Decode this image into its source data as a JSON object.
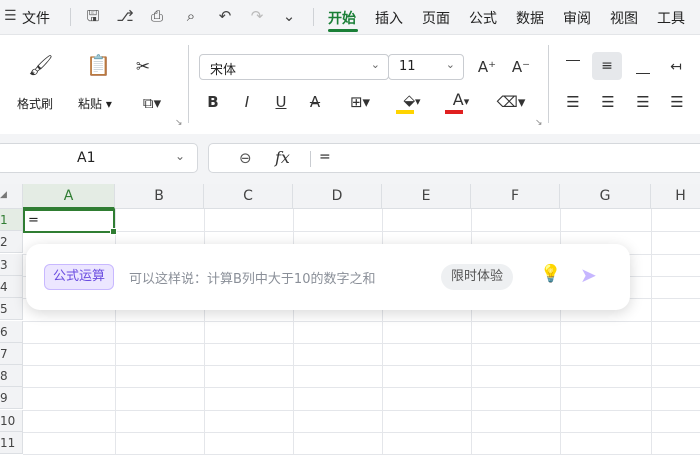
{
  "menubar": {
    "file_label": "文件",
    "tabs": [
      "开始",
      "插入",
      "页面",
      "公式",
      "数据",
      "审阅",
      "视图",
      "工具"
    ],
    "active_tab_color": "#1a7f37"
  },
  "ribbon": {
    "format_painter_label": "格式刷",
    "paste_label": "粘贴",
    "font_name": "宋体",
    "font_size": "11",
    "bold": "B",
    "italic": "I",
    "underline": "U",
    "strikethrough": "A",
    "grow_font": "A⁺",
    "shrink_font": "A⁻",
    "font_color": "A",
    "highlight_color": "#ffd400",
    "font_color_bar": "#e02020"
  },
  "formula_bar": {
    "cell_ref": "A1",
    "fx_label": "fx",
    "content": "="
  },
  "sheet": {
    "columns": [
      "A",
      "B",
      "C",
      "D",
      "E",
      "F",
      "G",
      "H"
    ],
    "rows": [
      "1",
      "2",
      "3",
      "4",
      "5",
      "6",
      "7",
      "8",
      "9",
      "10",
      "11"
    ],
    "active_cell_value": "="
  },
  "ai_popup": {
    "tag": "公式运算",
    "placeholder": "可以这样说：计算B列中大于10的数字之和",
    "badge": "限时体验",
    "accent": "#7b5cf0"
  }
}
